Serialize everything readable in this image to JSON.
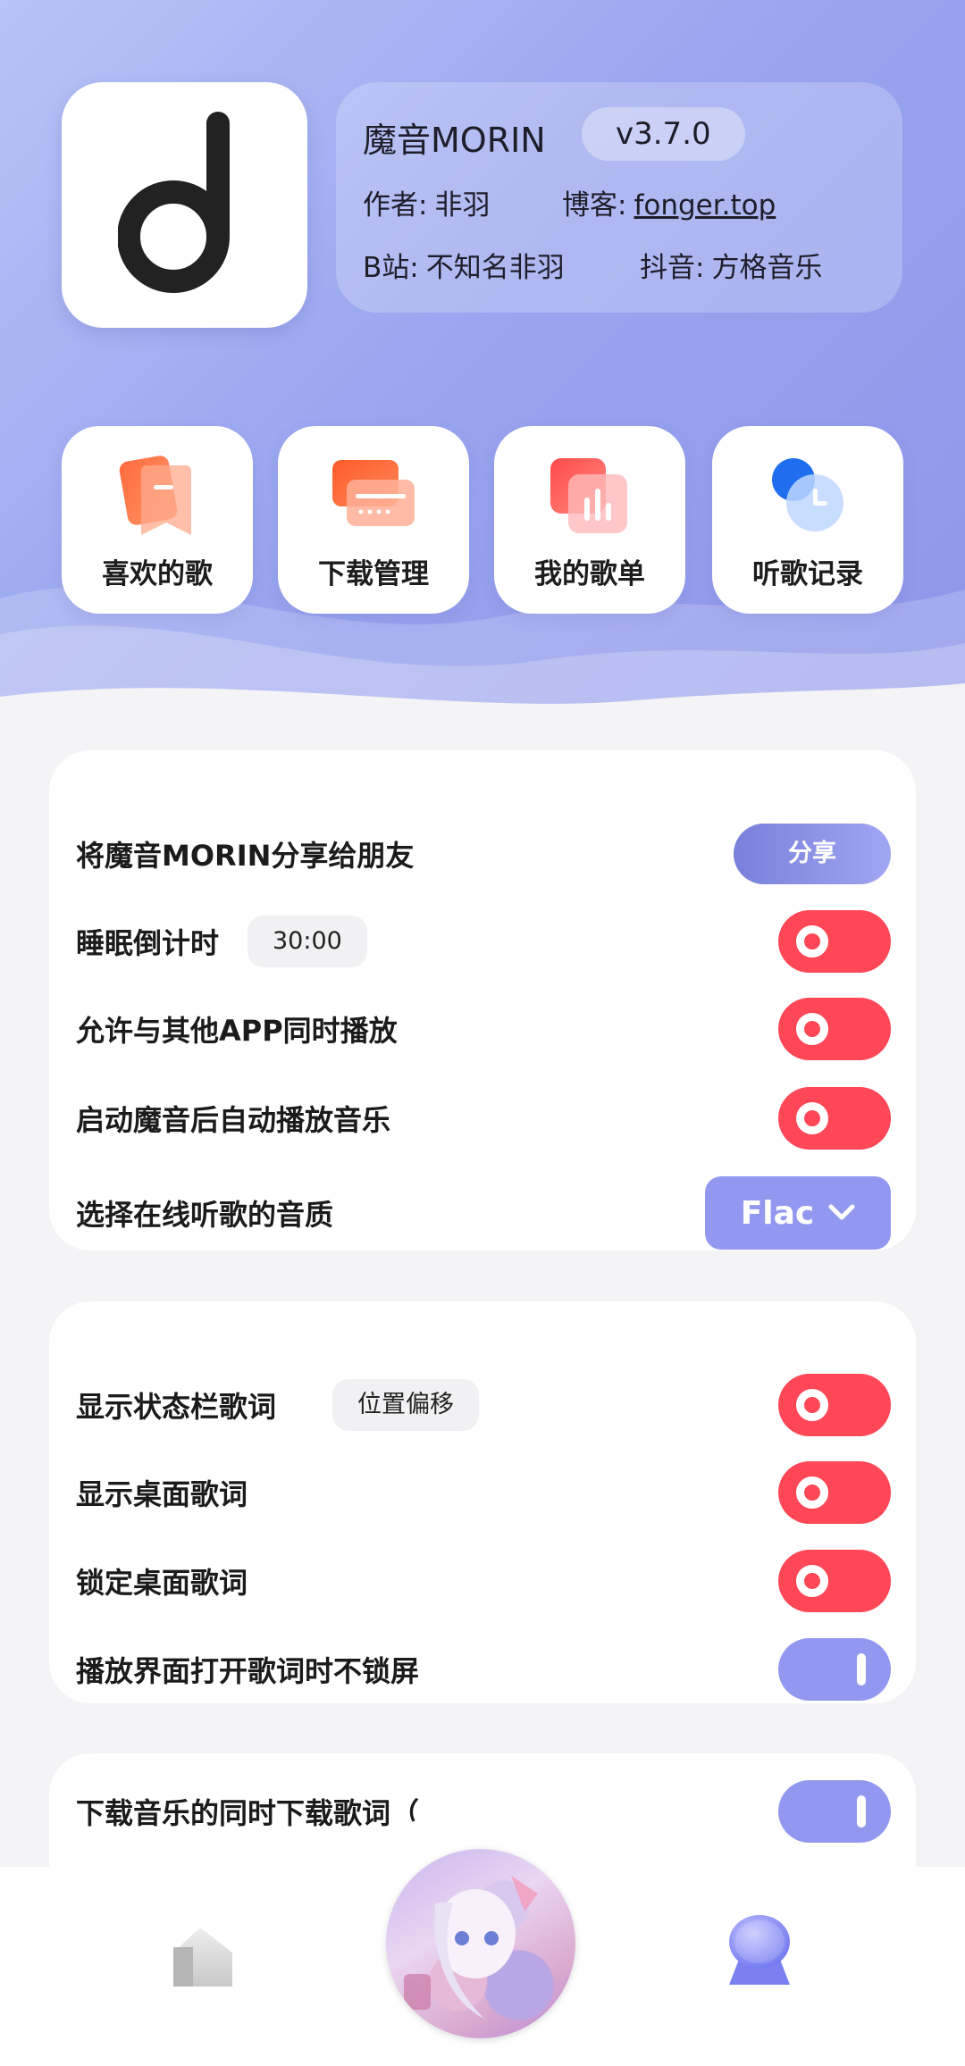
{
  "header": {
    "app_name": "魔音MORIN",
    "version": "v3.7.0",
    "author_label": "作者:",
    "author_value": "非羽",
    "blog_label": "博客:",
    "blog_value": "fonger.top",
    "bilibili_label": "B站:",
    "bilibili_value": "不知名非羽",
    "douyin_label": "抖音:",
    "douyin_value": "方格音乐",
    "logo_icon": "music-note-d-logo"
  },
  "quick_actions": [
    {
      "label": "喜欢的歌",
      "icon": "bookmark-heart-icon"
    },
    {
      "label": "下载管理",
      "icon": "download-stack-icon"
    },
    {
      "label": "我的歌单",
      "icon": "playlist-bars-icon"
    },
    {
      "label": "听歌记录",
      "icon": "history-clock-icon"
    }
  ],
  "card1": {
    "share_label": "将魔音MORIN分享给朋友",
    "share_button": "分享",
    "sleep_label": "睡眠倒计时",
    "sleep_time": "30:00",
    "mix_label": "允许与其他APP同时播放",
    "autoplay_label": "启动魔音后自动播放音乐",
    "quality_label": "选择在线听歌的音质",
    "quality_value": "Flac"
  },
  "card2": {
    "statusbar_label": "显示状态栏歌词",
    "offset_chip": "位置偏移",
    "desktop_label": "显示桌面歌词",
    "lock_label": "锁定桌面歌词",
    "nolock_label": "播放界面打开歌词时不锁屏"
  },
  "card3": {
    "download_lyrics_label": "下载音乐的同时下载歌词（"
  },
  "toggles": {
    "sleep_timer": false,
    "mix_playback": false,
    "autoplay": false,
    "statusbar_lyrics": false,
    "desktop_lyrics": false,
    "lock_desktop_lyrics": false,
    "no_lock_screen": true,
    "download_lyrics": true
  },
  "colors": {
    "accent": "#9298f0",
    "toggle_off": "#ff4757",
    "hero_start": "#b8c4f6",
    "hero_end": "#8e96ea"
  },
  "bottom_nav": {
    "home_icon": "home-icon",
    "player_icon": "now-playing-cover",
    "user_icon": "user-icon"
  }
}
